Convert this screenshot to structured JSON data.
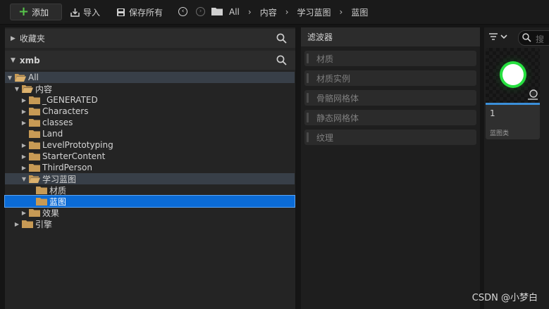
{
  "toolbar": {
    "add_label": "添加",
    "import_label": "导入",
    "save_all_label": "保存所有",
    "breadcrumb": [
      "All",
      "内容",
      "学习蓝图",
      "蓝图"
    ]
  },
  "left_panel": {
    "favorites_label": "收藏夹",
    "root_label": "xmb",
    "tree": [
      {
        "label": "All",
        "depth": 0,
        "arrow": "▼",
        "open": true
      },
      {
        "label": "内容",
        "depth": 1,
        "arrow": "▼",
        "open": true
      },
      {
        "label": "_GENERATED",
        "depth": 2,
        "arrow": "▶"
      },
      {
        "label": "Characters",
        "depth": 2,
        "arrow": "▶"
      },
      {
        "label": "classes",
        "depth": 2,
        "arrow": "▶"
      },
      {
        "label": "Land",
        "depth": 2,
        "arrow": ""
      },
      {
        "label": "LevelPrototyping",
        "depth": 2,
        "arrow": "▶"
      },
      {
        "label": "StarterContent",
        "depth": 2,
        "arrow": "▶"
      },
      {
        "label": "ThirdPerson",
        "depth": 2,
        "arrow": "▶"
      },
      {
        "label": "学习蓝图",
        "depth": 2,
        "arrow": "▼",
        "open": true
      },
      {
        "label": "材质",
        "depth": 3,
        "arrow": ""
      },
      {
        "label": "蓝图",
        "depth": 3,
        "arrow": "",
        "selected": true
      },
      {
        "label": "效果",
        "depth": 2,
        "arrow": "▶"
      },
      {
        "label": "引擎",
        "depth": 1,
        "arrow": "▶"
      }
    ]
  },
  "filter_panel": {
    "title": "滤波器",
    "items": [
      "材质",
      "材质实例",
      "骨骼网格体",
      "静态网格体",
      "纹理"
    ]
  },
  "asset_panel": {
    "search_placeholder": "搜",
    "asset": {
      "name": "1",
      "type": "蓝图类"
    }
  },
  "watermark": "CSDN @小梦白",
  "colors": {
    "accent": "#0b6bd6",
    "add_green": "#57c44b",
    "folder": "#c79a55",
    "asset_glow": "#27e040"
  }
}
